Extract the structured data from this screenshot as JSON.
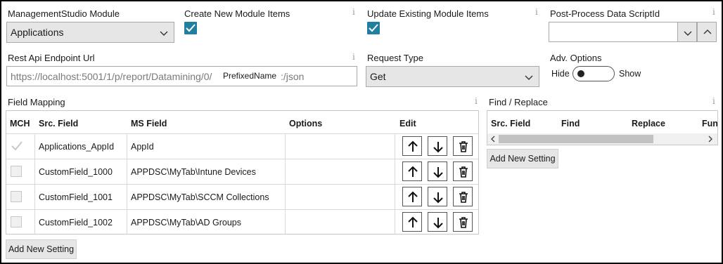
{
  "module": {
    "label": "ManagementStudio Module",
    "value": "Applications"
  },
  "create_items": {
    "label": "Create New Module Items",
    "checked": true
  },
  "update_items": {
    "label": "Update Existing Module Items",
    "checked": true
  },
  "post_process": {
    "label": "Post-Process Data ScriptId",
    "value": ""
  },
  "endpoint": {
    "label": "Rest Api Endpoint Url",
    "value": "https://localhost:5001/1/p/report/Datamining/0/",
    "tooltip": "PrefixedName",
    "suffix": ":/json"
  },
  "request_type": {
    "label": "Request Type",
    "value": "Get"
  },
  "adv_options": {
    "label": "Adv. Options",
    "off_label": "Hide",
    "on_label": "Show",
    "on": false
  },
  "info_glyph": "i",
  "field_mapping": {
    "title": "Field Mapping",
    "columns": [
      "MCH",
      "Src. Field",
      "MS Field",
      "Options",
      "Edit"
    ],
    "rows": [
      {
        "mch": true,
        "src": "Applications_AppId",
        "ms": "AppId",
        "options": ""
      },
      {
        "mch": false,
        "src": "CustomField_1000",
        "ms": "APPDSC\\MyTab\\Intune Devices",
        "options": ""
      },
      {
        "mch": false,
        "src": "CustomField_1001",
        "ms": "APPDSC\\MyTab\\SCCM Collections",
        "options": ""
      },
      {
        "mch": false,
        "src": "CustomField_1002",
        "ms": "APPDSC\\MyTab\\AD Groups",
        "options": ""
      }
    ],
    "add_button": "Add New Setting"
  },
  "find_replace": {
    "title": "Find / Replace",
    "columns": [
      "Src. Field",
      "Find",
      "Replace",
      "Fun"
    ],
    "add_button": "Add New Setting"
  },
  "colors": {
    "accent": "#1f7f9e",
    "control_bg": "#e6e6e6",
    "border": "#a9a9a9"
  }
}
